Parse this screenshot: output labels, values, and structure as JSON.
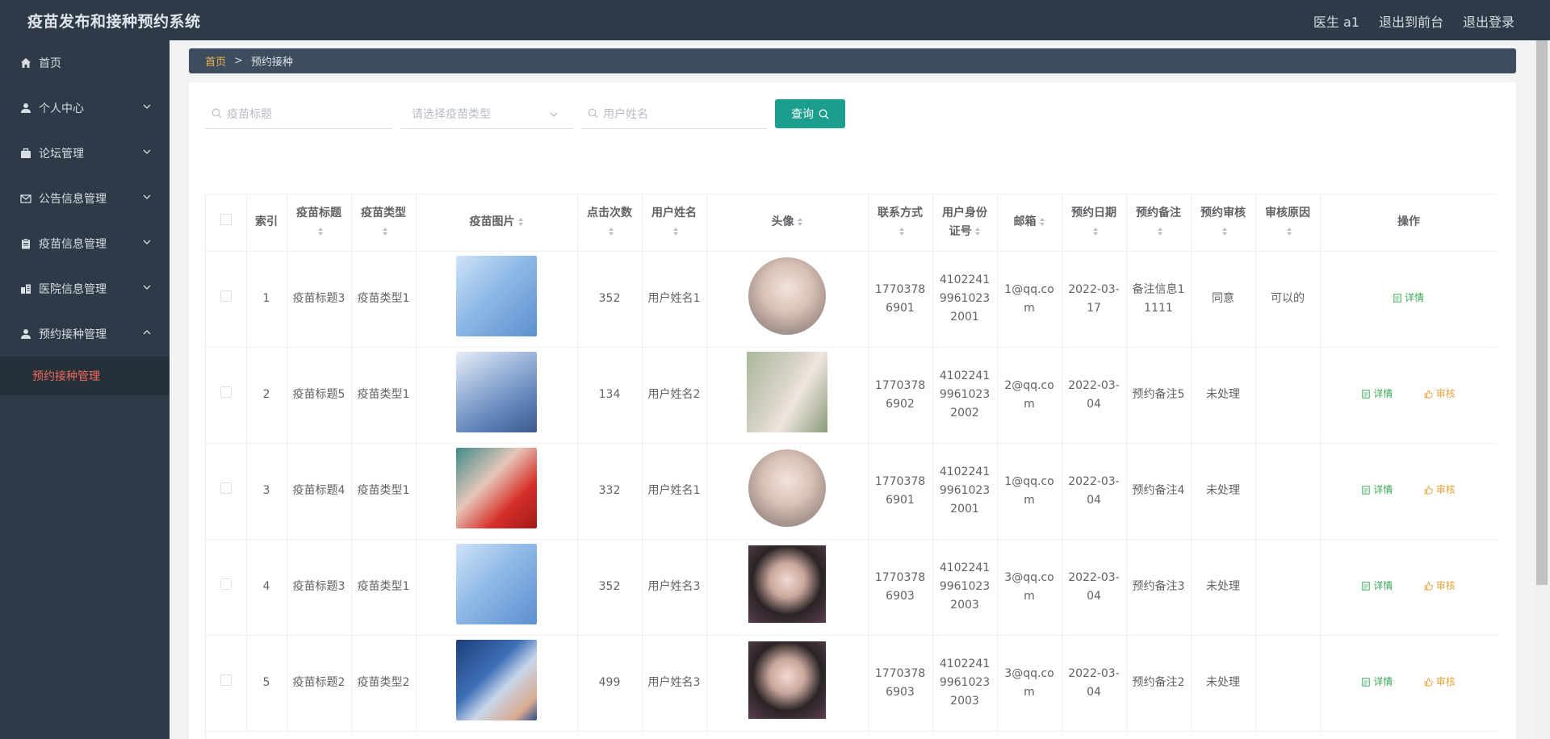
{
  "app": {
    "title": "疫苗发布和接种预约系统"
  },
  "topbar": {
    "user": "医生 a1",
    "to_front": "退出到前台",
    "logout": "退出登录"
  },
  "sidebar": {
    "items": [
      {
        "label": "首页",
        "icon": "home-icon"
      },
      {
        "label": "个人中心",
        "icon": "user-icon"
      },
      {
        "label": "论坛管理",
        "icon": "briefcase-icon"
      },
      {
        "label": "公告信息管理",
        "icon": "mail-icon"
      },
      {
        "label": "疫苗信息管理",
        "icon": "clipboard-icon"
      },
      {
        "label": "医院信息管理",
        "icon": "building-icon"
      },
      {
        "label": "预约接种管理",
        "icon": "user-icon"
      }
    ],
    "submenu": "预约接种管理"
  },
  "breadcrumb": {
    "home": "首页",
    "separator": ">",
    "current": "预约接种"
  },
  "search": {
    "vaccine_title_placeholder": "疫苗标题",
    "vaccine_type_placeholder": "请选择疫苗类型",
    "user_name_placeholder": "用户姓名",
    "button": "查询"
  },
  "table": {
    "headers": {
      "index": "索引",
      "vaccine_title": "疫苗标题",
      "vaccine_type": "疫苗类型",
      "vaccine_image": "疫苗图片",
      "clicks": "点击次数",
      "user_name": "用户姓名",
      "avatar": "头像",
      "phone": "联系方式",
      "id_card": "用户身份证号",
      "email": "邮箱",
      "date": "预约日期",
      "note": "预约备注",
      "review": "预约审核",
      "reason": "审核原因",
      "ops": "操作"
    },
    "actions": {
      "detail": "详情",
      "review": "审核"
    },
    "rows": [
      {
        "index": "1",
        "vaccine_title": "疫苗标题3",
        "vaccine_type": "疫苗类型1",
        "clicks": "352",
        "user_name": "用户姓名1",
        "phone": "17703786901",
        "id_card": "410224199610232001",
        "email": "1@qq.com",
        "date": "2022-03-17",
        "note": "备注信息11111",
        "review": "同意",
        "reason": "可以的"
      },
      {
        "index": "2",
        "vaccine_title": "疫苗标题5",
        "vaccine_type": "疫苗类型1",
        "clicks": "134",
        "user_name": "用户姓名2",
        "phone": "17703786902",
        "id_card": "410224199610232002",
        "email": "2@qq.com",
        "date": "2022-03-04",
        "note": "预约备注5",
        "review": "未处理",
        "reason": ""
      },
      {
        "index": "3",
        "vaccine_title": "疫苗标题4",
        "vaccine_type": "疫苗类型1",
        "clicks": "332",
        "user_name": "用户姓名1",
        "phone": "17703786901",
        "id_card": "410224199610232001",
        "email": "1@qq.com",
        "date": "2022-03-04",
        "note": "预约备注4",
        "review": "未处理",
        "reason": ""
      },
      {
        "index": "4",
        "vaccine_title": "疫苗标题3",
        "vaccine_type": "疫苗类型1",
        "clicks": "352",
        "user_name": "用户姓名3",
        "phone": "17703786903",
        "id_card": "410224199610232003",
        "email": "3@qq.com",
        "date": "2022-03-04",
        "note": "预约备注3",
        "review": "未处理",
        "reason": ""
      },
      {
        "index": "5",
        "vaccine_title": "疫苗标题2",
        "vaccine_type": "疫苗类型2",
        "clicks": "499",
        "user_name": "用户姓名3",
        "phone": "17703786903",
        "id_card": "410224199610232003",
        "email": "3@qq.com",
        "date": "2022-03-04",
        "note": "预约备注2",
        "review": "未处理",
        "reason": ""
      }
    ]
  },
  "colors": {
    "header_bg": "#2e3a47",
    "accent_teal": "#1b9e8d",
    "active_menu": "#f2685b",
    "breadcrumb_home": "#f0b44b",
    "detail_green": "#3aa757",
    "review_orange": "#e6a23c"
  }
}
